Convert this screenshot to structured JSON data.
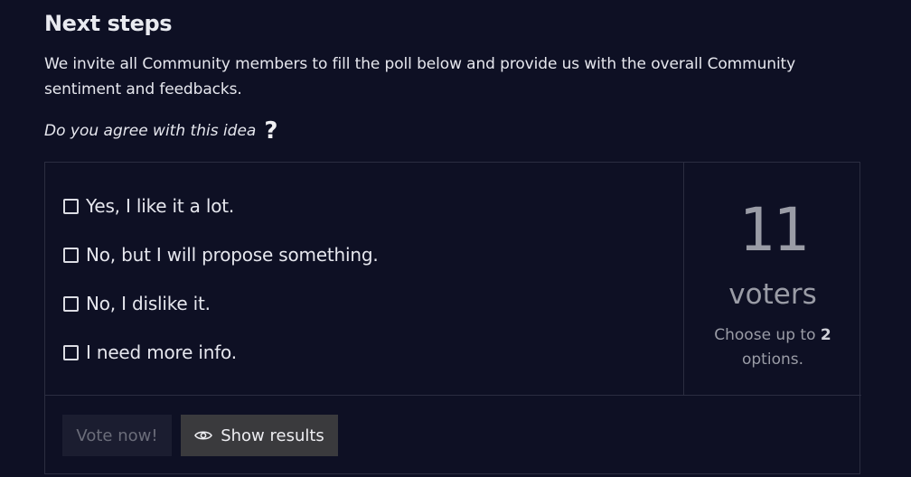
{
  "section": {
    "title": "Next steps",
    "intro": "We invite all Community members to fill the poll below and provide us with the overall Community sentiment and feedbacks."
  },
  "poll": {
    "question": "Do you agree with this idea",
    "question_icon": "?",
    "options": [
      {
        "label": "Yes, I like it a lot.",
        "checked": false
      },
      {
        "label": "No, but I will propose something.",
        "checked": false
      },
      {
        "label": "No, I dislike it.",
        "checked": false
      },
      {
        "label": "I need more info.",
        "checked": false
      }
    ],
    "voter_count": "11",
    "voters_label": "voters",
    "choose_prefix": "Choose up to",
    "choose_max": "2",
    "choose_suffix": "options.",
    "vote_button": "Vote now!",
    "results_button": "Show results"
  },
  "colors": {
    "background": "#0e1024",
    "border": "#2b2d40",
    "text": "#e6e7ee",
    "muted": "#9a9ca6",
    "vote_button_bg": "#1b1d30",
    "results_button_bg": "#3a3a3d"
  },
  "icons": {
    "checkbox": "checkbox-icon",
    "results": "eye-icon"
  }
}
